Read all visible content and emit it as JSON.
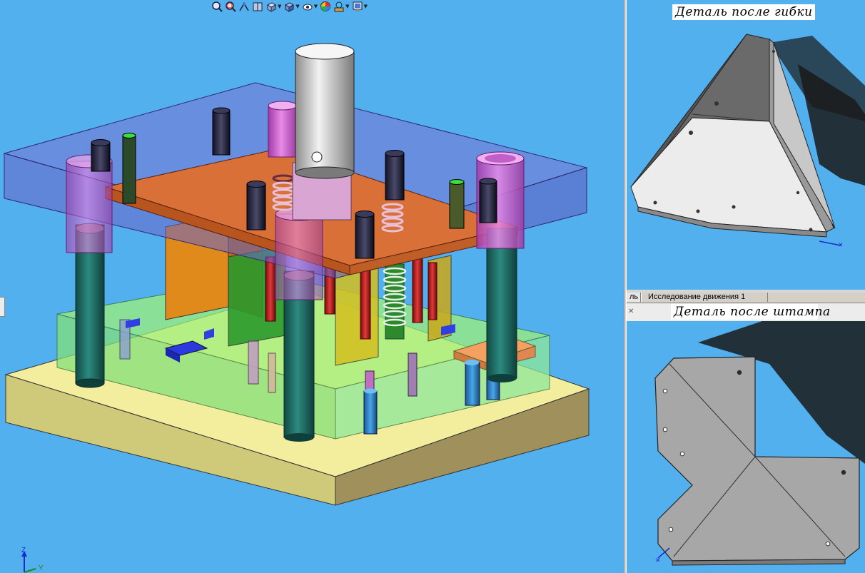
{
  "toolbar": {
    "items": [
      {
        "icon": "zoom-to-fit-icon",
        "dropdown": false
      },
      {
        "icon": "zoom-to-area-icon",
        "dropdown": false
      },
      {
        "icon": "previous-view-icon",
        "dropdown": false
      },
      {
        "icon": "section-view-icon",
        "dropdown": false
      },
      {
        "icon": "view-orientation-icon",
        "dropdown": true
      },
      {
        "icon": "display-style-icon",
        "dropdown": true
      },
      {
        "icon": "hide-show-items-icon",
        "dropdown": true
      },
      {
        "icon": "edit-appearance-icon",
        "dropdown": false
      },
      {
        "icon": "apply-scene-icon",
        "dropdown": true
      },
      {
        "icon": "view-settings-icon",
        "dropdown": true
      }
    ]
  },
  "viewports": {
    "top_caption": "Деталь после гибки",
    "bottom_caption": "Деталь после штампа"
  },
  "tabs": {
    "model_fragment": "ль",
    "motion_study": "Исследование движения 1"
  },
  "triad": {
    "z": "Z",
    "y": "Y"
  },
  "colors": {
    "viewport_bg": "#53b0ee",
    "die_base": "#eee89a",
    "punch_plate": "#d86a33",
    "transparent_plate": "#6f74cf",
    "pillar": "#1f6a62",
    "bushing": "#d46ad6",
    "spring": "#e8bcd8",
    "sheet_part": "#9b9b9b"
  }
}
